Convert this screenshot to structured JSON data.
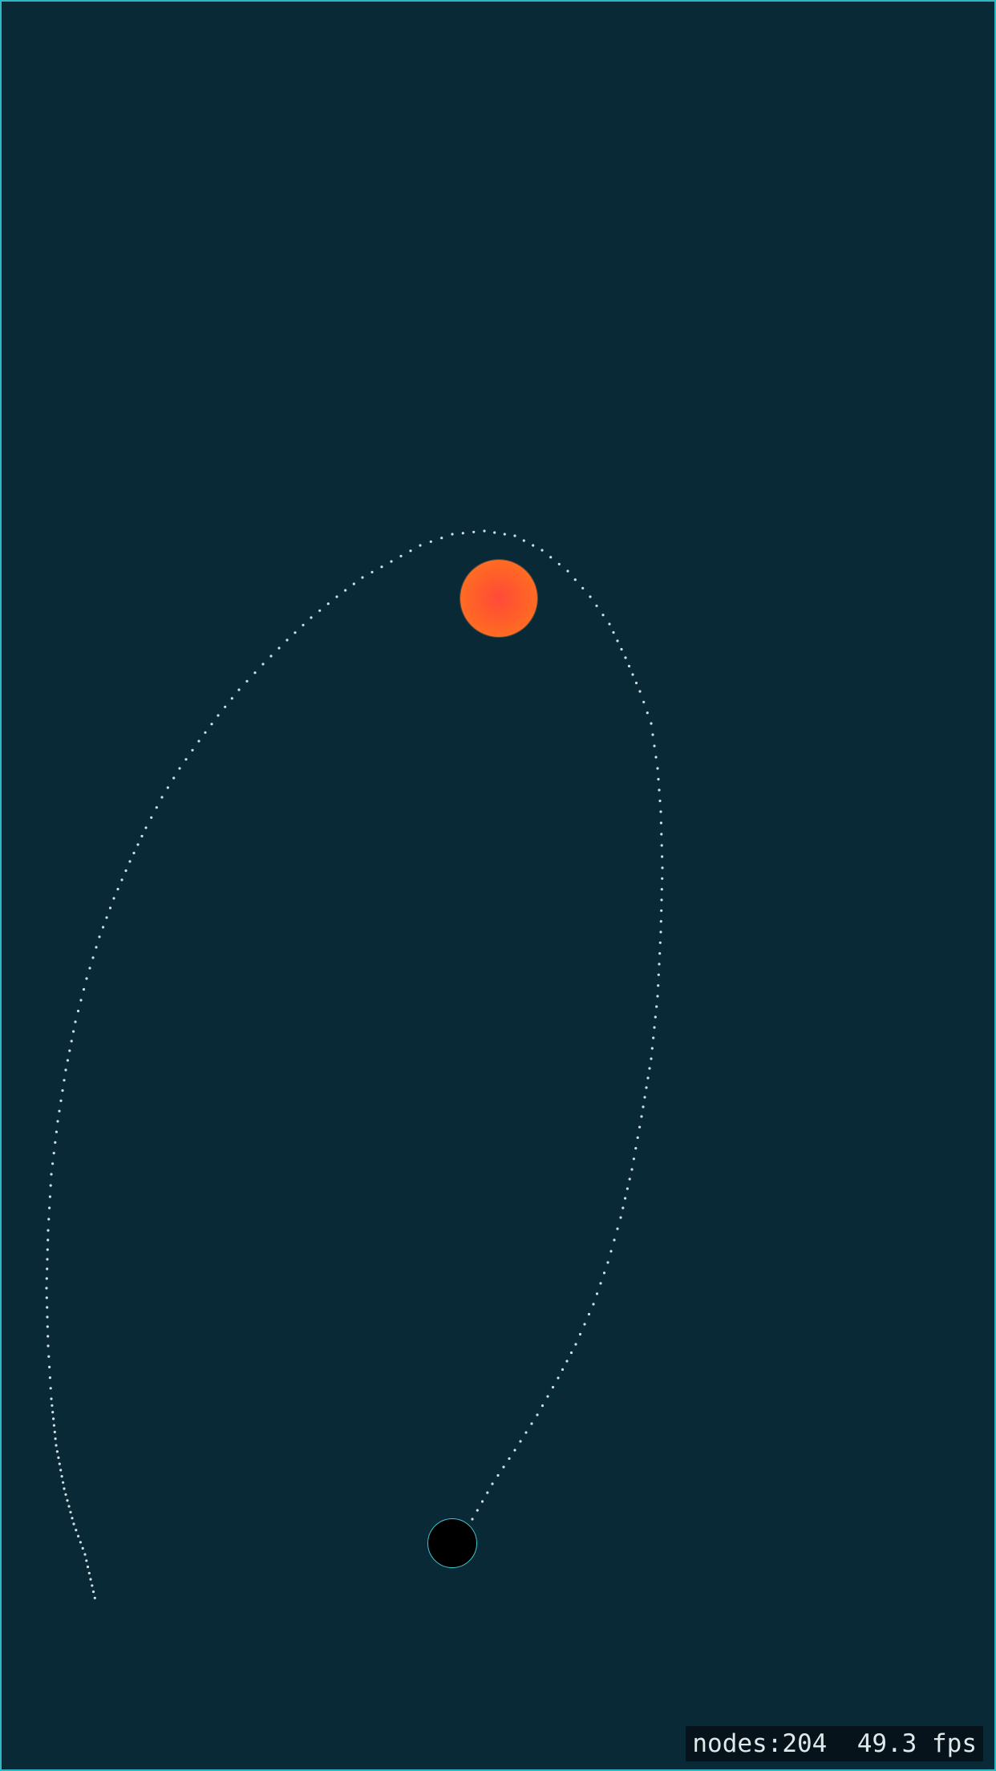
{
  "colors": {
    "background": "#0a2936",
    "frame": "#2fb8c4",
    "sun": "#ff6a24",
    "planet": "#000000",
    "planet_outline": "#3fc9d2",
    "trail": "#cfe0e4"
  },
  "hud": {
    "nodes_label": "nodes:204",
    "fps_label": "49.3 fps"
  }
}
